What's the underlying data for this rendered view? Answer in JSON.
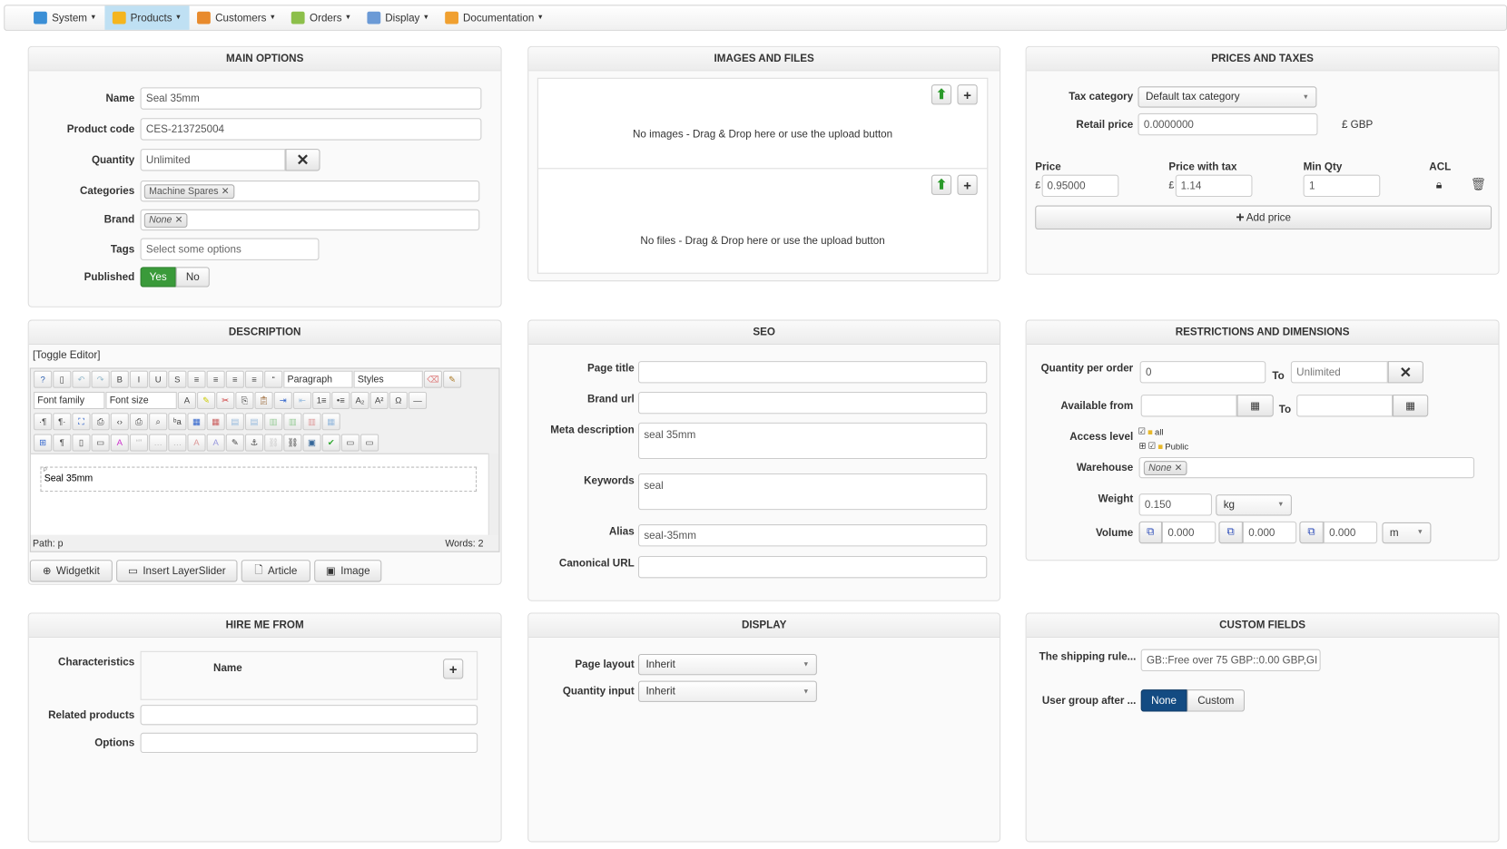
{
  "menu": [
    {
      "label": "System",
      "icon": "tools-icon",
      "color": "#3b8fd6"
    },
    {
      "label": "Products",
      "icon": "box-icon",
      "color": "#f5b51d",
      "active": true
    },
    {
      "label": "Customers",
      "icon": "users-icon",
      "color": "#e88a2c"
    },
    {
      "label": "Orders",
      "icon": "orders-icon",
      "color": "#8cbf4a"
    },
    {
      "label": "Display",
      "icon": "display-icon",
      "color": "#6b9ad6"
    },
    {
      "label": "Documentation",
      "icon": "docs-icon",
      "color": "#f0a030"
    }
  ],
  "main_options": {
    "title": "MAIN OPTIONS",
    "name_label": "Name",
    "name": "Seal 35mm",
    "code_label": "Product code",
    "code": "CES-213725004",
    "qty_label": "Quantity",
    "qty": "Unlimited",
    "cat_label": "Categories",
    "category": "Machine Spares",
    "brand_label": "Brand",
    "brand": "None",
    "tags_label": "Tags",
    "tags_placeholder": "Select some options",
    "pub_label": "Published",
    "yes": "Yes",
    "no": "No"
  },
  "images": {
    "title": "IMAGES AND FILES",
    "no_images": "No images - Drag & Drop here or use the upload button",
    "no_files": "No files - Drag & Drop here or use the upload button"
  },
  "prices": {
    "title": "PRICES AND TAXES",
    "tax_label": "Tax category",
    "tax": "Default tax category",
    "retail_label": "Retail price",
    "retail": "0.0000000",
    "currency": "£ GBP",
    "price_label": "Price",
    "price_tax_label": "Price with tax",
    "minqty_label": "Min Qty",
    "acl_label": "ACL",
    "symbol": "£",
    "price": "0.95000",
    "price_tax": "1.14",
    "minqty": "1",
    "add": "Add price"
  },
  "description": {
    "title": "DESCRIPTION",
    "toggle": "[Toggle Editor]",
    "paragraph": "Paragraph",
    "styles": "Styles",
    "font_family": "Font family",
    "font_size": "Font size",
    "content": "Seal 35mm",
    "p_marker": "P",
    "path": "Path: p",
    "words": "Words: 2",
    "buttons": [
      "Widgetkit",
      "Insert LayerSlider",
      "Article",
      "Image"
    ]
  },
  "seo": {
    "title": "SEO",
    "page_title_label": "Page title",
    "page_title": "",
    "brand_url_label": "Brand url",
    "brand_url": "",
    "meta_label": "Meta description",
    "meta": "seal 35mm",
    "keywords_label": "Keywords",
    "keywords": "seal",
    "alias_label": "Alias",
    "alias": "seal-35mm",
    "canonical_label": "Canonical URL",
    "canonical": ""
  },
  "restrictions": {
    "title": "RESTRICTIONS AND DIMENSIONS",
    "qpo_label": "Quantity per order",
    "qpo": "0",
    "to": "To",
    "qpo_to": "Unlimited",
    "avail_label": "Available from",
    "access_label": "Access level",
    "access_all": "all",
    "access_public": "Public",
    "warehouse_label": "Warehouse",
    "warehouse": "None",
    "weight_label": "Weight",
    "weight": "0.150",
    "weight_unit": "kg",
    "volume_label": "Volume",
    "vol": [
      "0.000",
      "0.000",
      "0.000"
    ],
    "vol_unit": "m"
  },
  "hire": {
    "title": "HIRE ME FROM",
    "char_label": "Characteristics",
    "name_col": "Name",
    "related_label": "Related products",
    "options_label": "Options"
  },
  "display": {
    "title": "DISPLAY",
    "layout_label": "Page layout",
    "layout": "Inherit",
    "qty_input_label": "Quantity input",
    "qty_input": "Inherit"
  },
  "custom": {
    "title": "CUSTOM FIELDS",
    "shipping_label": "The shipping rule...",
    "shipping": "GB::Free over 75 GBP::0.00 GBP,GI",
    "usergroup_label": "User group after ...",
    "none": "None",
    "custom": "Custom",
    "accent": "#134b82"
  }
}
